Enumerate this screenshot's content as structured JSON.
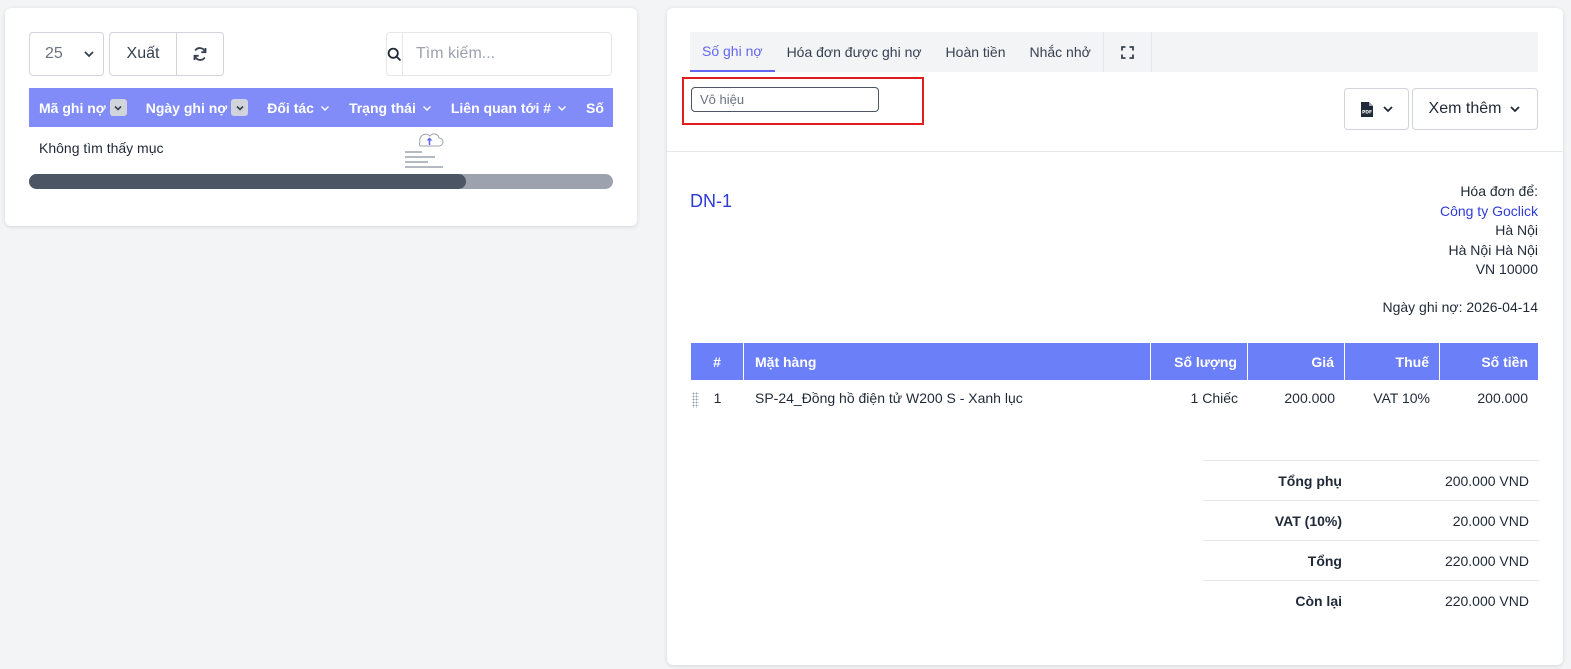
{
  "list": {
    "per_page": "25",
    "export_label": "Xuất",
    "search_placeholder": "Tìm kiếm...",
    "columns": [
      "Mã ghi nợ",
      "Ngày ghi nợ",
      "Đối tác",
      "Trạng thái",
      "Liên quan tới #",
      "Số"
    ],
    "empty_text": "Không tìm thấy mục",
    "scroll_position": 0.75
  },
  "detail": {
    "tabs": [
      "Số ghi nợ",
      "Hóa đơn được ghi nợ",
      "Hoàn tiền",
      "Nhắc nhở"
    ],
    "status_value": "Vô hiệu",
    "more_label": "Xem thêm",
    "doc_number": "DN-1",
    "bill_to": {
      "label": "Hóa đơn để:",
      "company": "Công ty Goclick",
      "city": "Hà Nội",
      "state_city": "Hà Nội Hà Nội",
      "country_zip": "VN 10000"
    },
    "date_label": "Ngày ghi nợ:",
    "date_value": "2026-04-14",
    "items_header": {
      "num": "#",
      "item": "Mặt hàng",
      "qty": "Số lượng",
      "price": "Giá",
      "tax": "Thuế",
      "amount": "Số tiền"
    },
    "items": [
      {
        "num": "1",
        "item": "SP-24_Đồng hồ điện tử W200 S - Xanh lục",
        "qty": "1 Chiếc",
        "price": "200.000",
        "tax": "VAT 10%",
        "amount": "200.000"
      }
    ],
    "totals": [
      {
        "label": "Tổng phụ",
        "value": "200.000 VND"
      },
      {
        "label": "VAT (10%)",
        "value": "20.000 VND"
      },
      {
        "label": "Tổng",
        "value": "220.000 VND"
      },
      {
        "label": "Còn lại",
        "value": "220.000 VND"
      }
    ]
  },
  "colors": {
    "table_header": "#818cf8",
    "items_header": "#6b7ff8",
    "accent": "#6366f1",
    "link": "#2f3bd8",
    "highlight": "#e11d1d"
  }
}
